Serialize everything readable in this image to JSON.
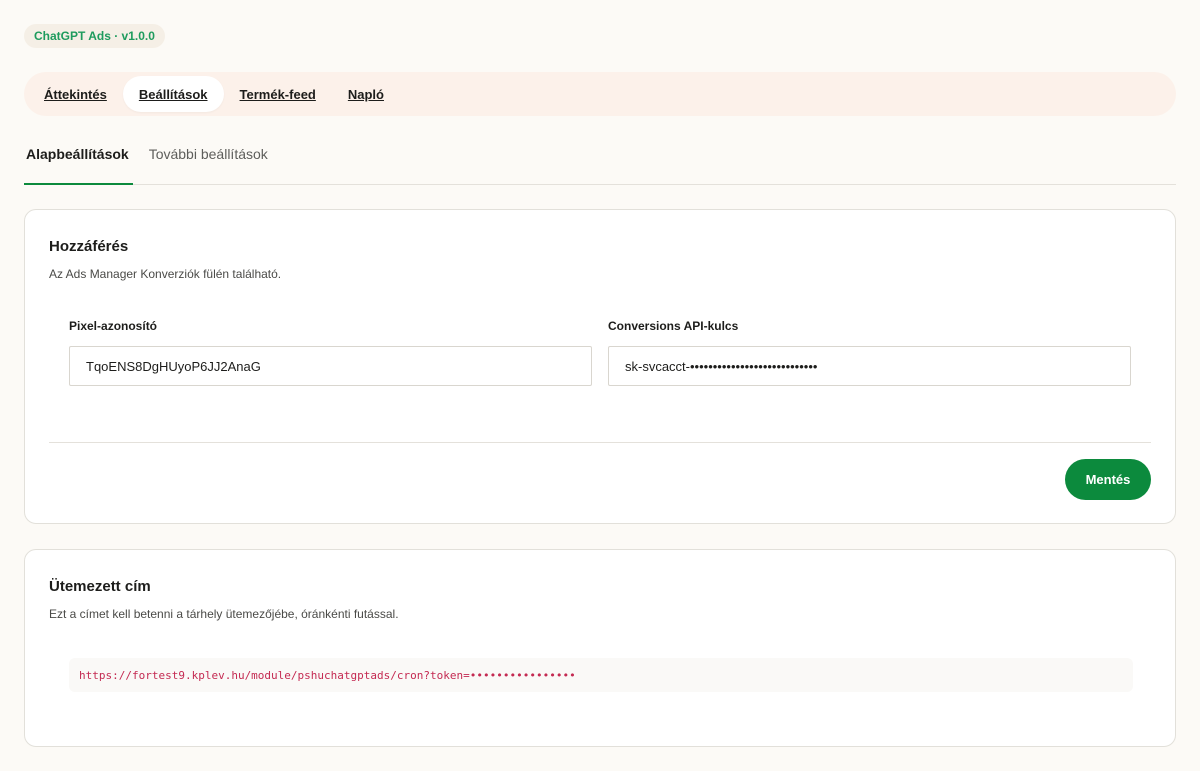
{
  "badge": "ChatGPT Ads · v1.0.0",
  "nav": {
    "items": [
      {
        "label": "Áttekintés"
      },
      {
        "label": "Beállítások"
      },
      {
        "label": "Termék-feed"
      },
      {
        "label": "Napló"
      }
    ],
    "active": "Beállítások"
  },
  "subtabs": {
    "items": [
      {
        "label": "Alapbeállítások"
      },
      {
        "label": "További beállítások"
      }
    ],
    "active": "Alapbeállítások"
  },
  "access": {
    "title": "Hozzáférés",
    "description": "Az Ads Manager Konverziók fülén található.",
    "pixel_label": "Pixel-azonosító",
    "pixel_value": "TqoENS8DgHUyoP6JJ2AnaG",
    "api_label": "Conversions API-kulcs",
    "api_value": "sk-svcacct-••••••••••••••••••••••••••••",
    "save_label": "Mentés"
  },
  "cron": {
    "title": "Ütemezett cím",
    "description": "Ezt a címet kell betenni a tárhely ütemezőjébe, óránkénti futással.",
    "url": "https://fortest9.kplev.hu/module/pshuchatgptads/cron?token=••••••••••••••••"
  },
  "colors": {
    "accent": "#0c8a3d",
    "badge_text": "#1e9b5d",
    "code_text": "#c42a52",
    "nav_bg": "#fcf1ea"
  }
}
